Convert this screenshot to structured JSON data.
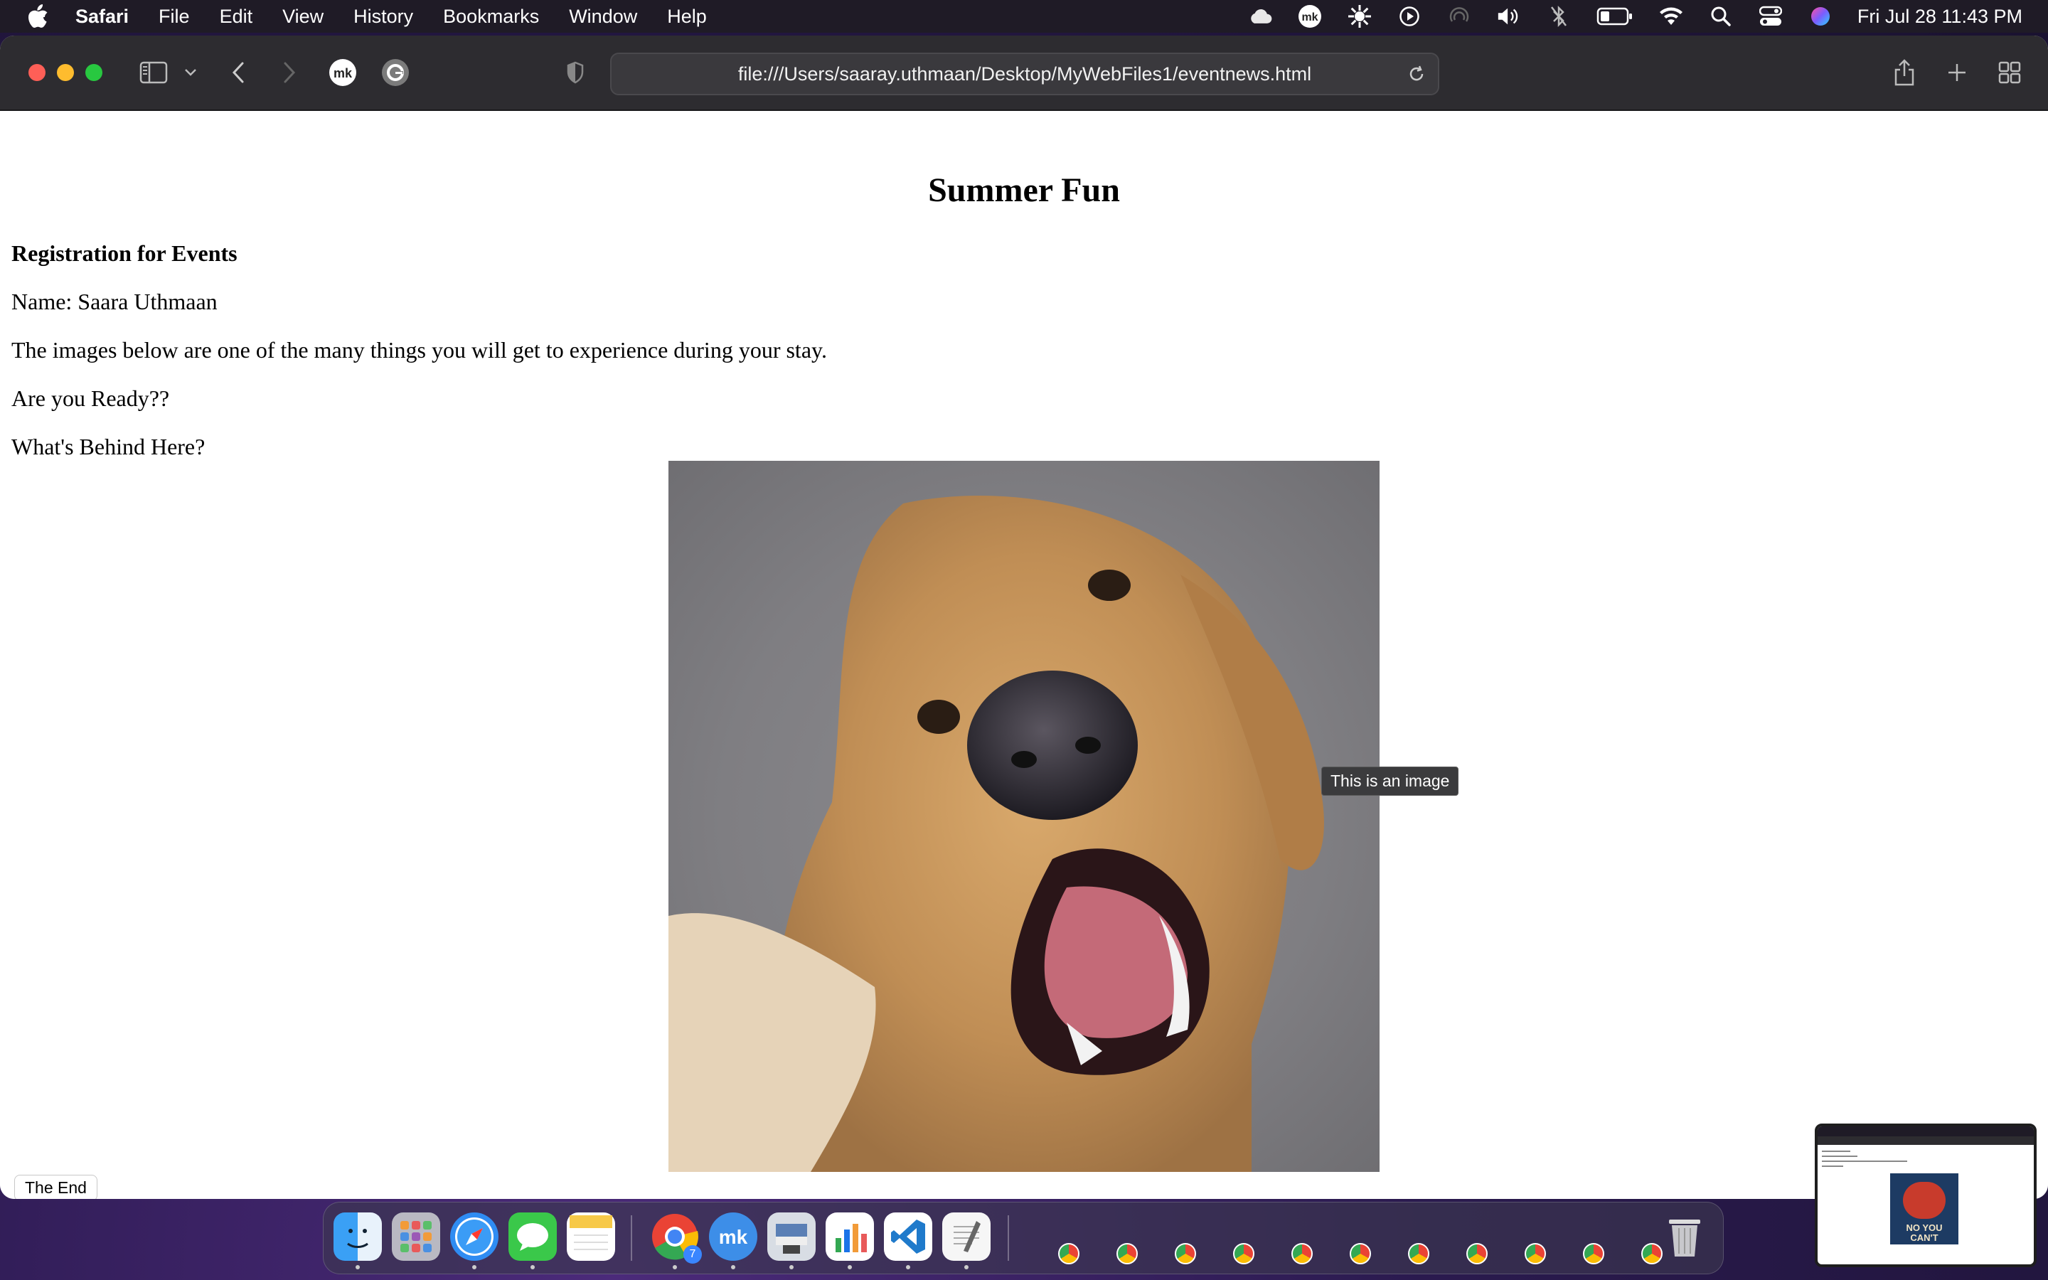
{
  "menubar": {
    "app_name": "Safari",
    "items": [
      "File",
      "Edit",
      "View",
      "History",
      "Bookmarks",
      "Window",
      "Help"
    ],
    "clock": "Fri Jul 28  11:43 PM"
  },
  "browser": {
    "url": "file:///Users/saaray.uthmaan/Desktop/MyWebFiles1/eventnews.html"
  },
  "page": {
    "title": "Summer Fun",
    "heading": "Registration for Events",
    "name_line": "Name: Saara Uthmaan",
    "intro": "The images below are one of the many things you will get to experience during your stay.",
    "question": "Are you Ready??",
    "prompt": "What's Behind Here?",
    "image_tooltip": "This is an image",
    "end_button": "The End"
  },
  "dock": {
    "chrome_badge": "7",
    "apps": [
      "finder-icon",
      "launchpad-icon",
      "safari-icon",
      "messages-icon",
      "notes-icon",
      "chrome-icon",
      "mk-app-icon",
      "preview-icon",
      "numbers-icon",
      "vscode-icon",
      "textedit-icon",
      "trash-icon"
    ]
  },
  "thumbnail": {
    "poster_text_1": "NO YOU",
    "poster_text_2": "CAN'T"
  }
}
